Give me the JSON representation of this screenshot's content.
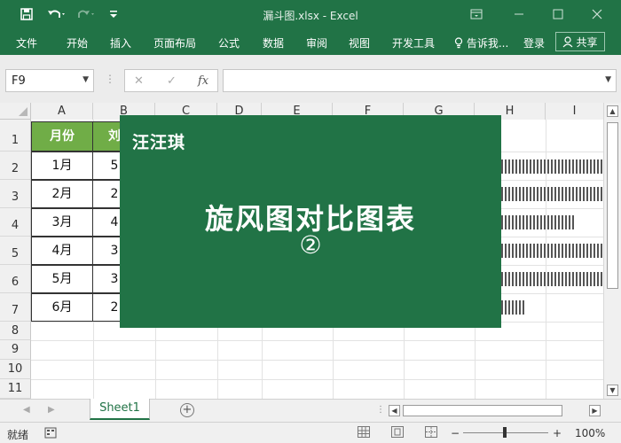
{
  "titlebar": {
    "title": "漏斗图.xlsx - Excel",
    "save_icon": "save-icon",
    "undo_icon": "undo-icon",
    "redo_icon": "redo-icon",
    "customize_icon": "customize-toolbar-icon",
    "ribbon_display_icon": "ribbon-display-options-icon",
    "minimize_icon": "minimize-icon",
    "maximize_icon": "maximize-icon",
    "close_icon": "close-icon"
  },
  "ribbon": {
    "tabs": [
      "文件",
      "开始",
      "插入",
      "页面布局",
      "公式",
      "数据",
      "审阅",
      "视图",
      "开发工具"
    ],
    "tell_me": "告诉我...",
    "login": "登录",
    "share": "共享"
  },
  "formula_bar": {
    "name_box": "F9",
    "cancel_symbol": "✕",
    "enter_symbol": "✓",
    "fx_symbol": "fx",
    "formula": ""
  },
  "columns": [
    "A",
    "B",
    "C",
    "D",
    "E",
    "F",
    "G",
    "H",
    "I"
  ],
  "rows": [
    "1",
    "2",
    "3",
    "4",
    "5",
    "6",
    "7",
    "8",
    "9",
    "10",
    "11"
  ],
  "table": {
    "header_a": "月份",
    "header_b": "刘",
    "months": [
      "1月",
      "2月",
      "3月",
      "4月",
      "5月",
      "6月"
    ],
    "b_values": [
      "5",
      "2",
      "4",
      "3",
      "3",
      "2"
    ]
  },
  "card": {
    "brand": "汪汪琪",
    "headline": "旋风图对比图表",
    "number": "②"
  },
  "sheets": {
    "active": "Sheet1",
    "add_label": "+"
  },
  "status": {
    "ready": "就绪",
    "zoom": "100%",
    "zoom_minus": "−",
    "zoom_plus": "+"
  },
  "colors": {
    "excel_green": "#217346",
    "header_fill": "#70ad47"
  }
}
